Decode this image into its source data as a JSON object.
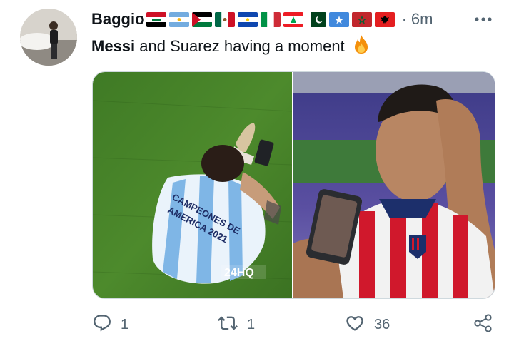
{
  "tweet": {
    "author_name": "Baggio",
    "time_sep": "·",
    "timestamp": "6m",
    "text_bold": "Messi",
    "text_rest": " and Suarez having a moment",
    "flags": [
      "iraq",
      "argentina",
      "palestine",
      "mexico",
      "el-salvador",
      "italy",
      "lebanon",
      "pakistan",
      "somalia",
      "morocco",
      "albania"
    ],
    "media": {
      "left_image": "messi-on-field-photo",
      "right_image": "suarez-crying-photo",
      "watermark": "24HQ",
      "shirt_text": "CAMPEONES DE AMERICA 2021"
    }
  },
  "actions": {
    "reply_count": "1",
    "retweet_count": "1",
    "like_count": "36"
  },
  "icons": [
    "more-icon",
    "fire-emoji-icon",
    "reply-icon",
    "retweet-icon",
    "like-icon",
    "share-icon"
  ],
  "colors": {
    "text": "#0f1419",
    "secondary": "#536471",
    "border": "#cfd9de"
  }
}
